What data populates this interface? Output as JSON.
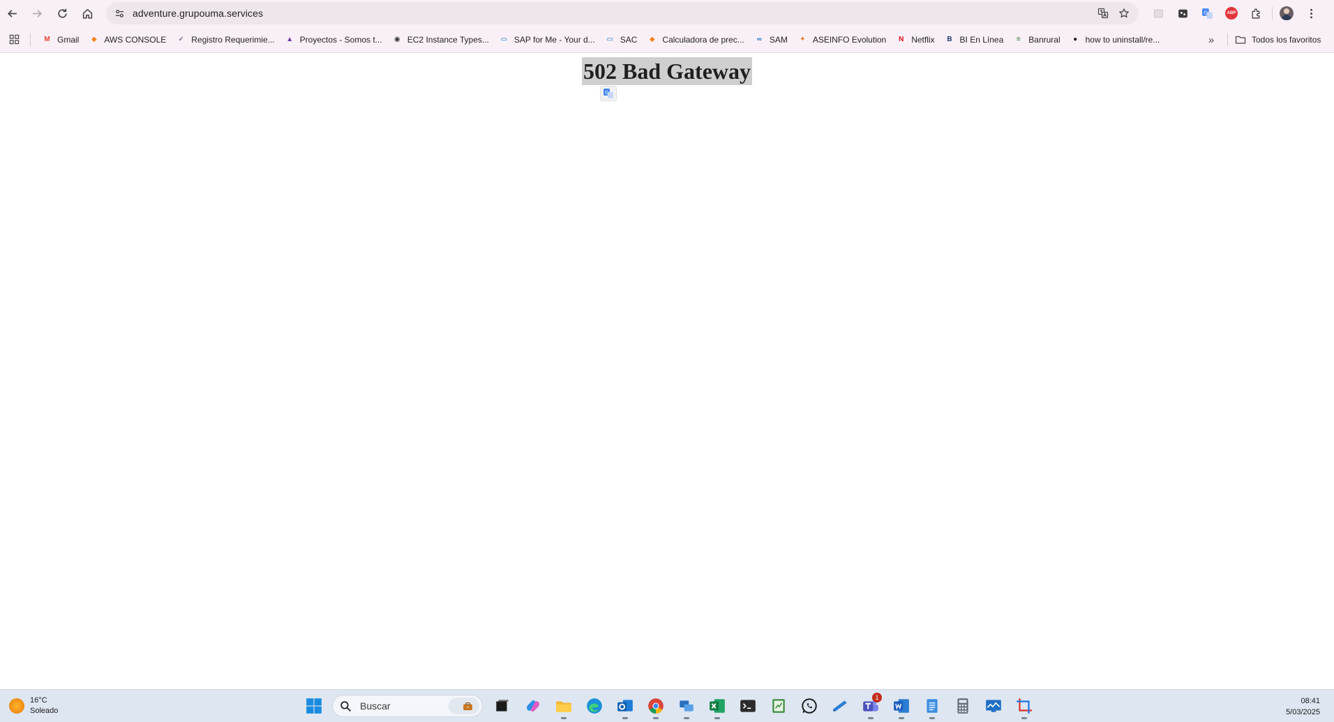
{
  "browser": {
    "url": "adventure.grupouma.services"
  },
  "bookmarks": [
    {
      "label": "Gmail",
      "icon": "gmail-icon",
      "color": "#ea4335"
    },
    {
      "label": "AWS CONSOLE",
      "icon": "aws-cube-icon",
      "color": "#f7821b"
    },
    {
      "label": "Registro Requerimie...",
      "icon": "registro-icon",
      "color": "#3c3a78"
    },
    {
      "label": "Proyectos - Somos t...",
      "icon": "proyectos-icon",
      "color": "#6d3aa6"
    },
    {
      "label": "EC2 Instance Types...",
      "icon": "ec2-icon",
      "color": "#333333"
    },
    {
      "label": "SAP for Me - Your d...",
      "icon": "sap-icon",
      "color": "#1a73c8"
    },
    {
      "label": "SAC",
      "icon": "sap-icon",
      "color": "#1a73c8"
    },
    {
      "label": "Calculadora de prec...",
      "icon": "aws-cube-icon",
      "color": "#f7821b"
    },
    {
      "label": "SAM",
      "icon": "sam-icon",
      "color": "#1a73c8"
    },
    {
      "label": "ASEINFO Evolution",
      "icon": "aseinfo-icon",
      "color": "#e8731a"
    },
    {
      "label": "Netflix",
      "icon": "netflix-icon",
      "color": "#e50914"
    },
    {
      "label": "BI En Línea",
      "icon": "bi-icon",
      "color": "#1f3b6f"
    },
    {
      "label": "Banrural",
      "icon": "banrural-icon",
      "color": "#2e7d32"
    },
    {
      "label": "how to uninstall/re...",
      "icon": "github-icon",
      "color": "#1f1f1f"
    }
  ],
  "all_bookmarks_label": "Todos los favoritos",
  "page": {
    "title": "502 Bad Gateway"
  },
  "taskbar": {
    "weather_temp": "16°C",
    "weather_desc": "Soleado",
    "search_placeholder": "Buscar",
    "teams_badge": "1",
    "time": "08:41",
    "date": "5/03/2025"
  }
}
